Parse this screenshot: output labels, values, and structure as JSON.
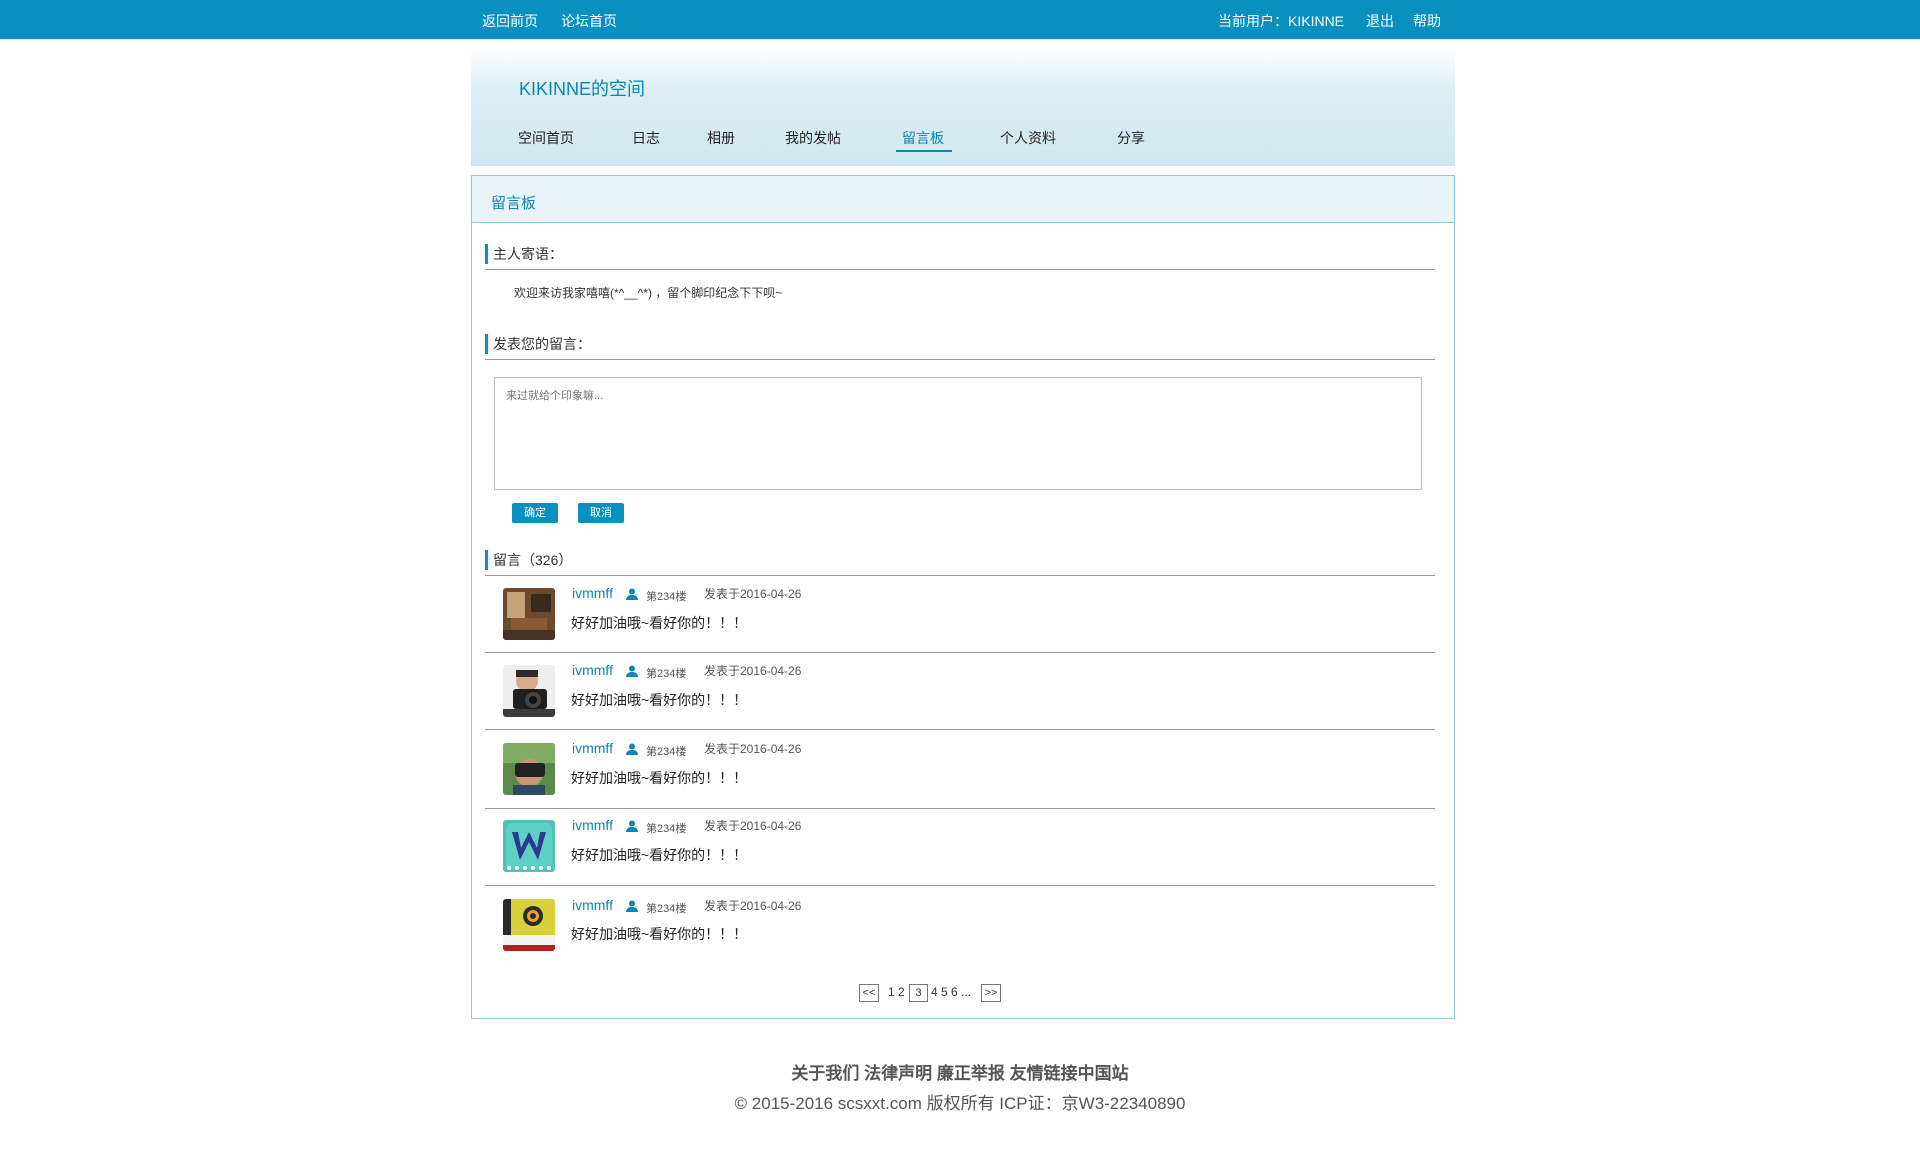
{
  "topbar": {
    "back_home": "返回前页",
    "forum_home": "论坛首页",
    "current_user": "当前用户：KIKINNE",
    "logout": "退出",
    "help": "帮助"
  },
  "header": {
    "title": "KIKINNE的空间",
    "nav": [
      "空间首页",
      "日志",
      "相册",
      "我的发帖",
      "留言板",
      "个人资料",
      "分享"
    ],
    "active_nav": "留言板"
  },
  "panel": {
    "title": "留言板",
    "host_section": "主人寄语：",
    "host_message": "欢迎来访我家嘻嘻(*^__^*) ，留个脚印纪念下下呗~",
    "post_section": "发表您的留言：",
    "textarea_placeholder": "来过就给个印象嘛...",
    "confirm_btn": "确定",
    "cancel_btn": "取消",
    "comments_section": "留言（326）"
  },
  "comments": [
    {
      "user": "ivmmff",
      "floor": "第234楼",
      "date": "发表于2016-04-26",
      "text": "好好加油哦~看好你的！！！",
      "avatar": "room-photo"
    },
    {
      "user": "ivmmff",
      "floor": "第234楼",
      "date": "发表于2016-04-26",
      "text": "好好加油哦~看好你的！！！",
      "avatar": "camera-man-photo"
    },
    {
      "user": "ivmmff",
      "floor": "第234楼",
      "date": "发表于2016-04-26",
      "text": "好好加油哦~看好你的！！！",
      "avatar": "vr-headset-photo"
    },
    {
      "user": "ivmmff",
      "floor": "第234楼",
      "date": "发表于2016-04-26",
      "text": "好好加油哦~看好你的！！！",
      "avatar": "w-logo"
    },
    {
      "user": "ivmmff",
      "floor": "第234楼",
      "date": "发表于2016-04-26",
      "text": "好好加油哦~看好你的！！！",
      "avatar": "camera-app-logo"
    }
  ],
  "pagination": {
    "prev": "<<",
    "pages_before": "1 2",
    "current": "3",
    "pages_after": "4 5 6 ...",
    "next": ">>"
  },
  "footer": {
    "links": "关于我们 法律声明 廉正举报 友情链接中国站",
    "copyright": "© 2015-2016 scsxxt.com 版权所有 ICP证：京W3-22340890"
  },
  "colors": {
    "brand": "#0891c0",
    "link": "#0b86b5"
  }
}
